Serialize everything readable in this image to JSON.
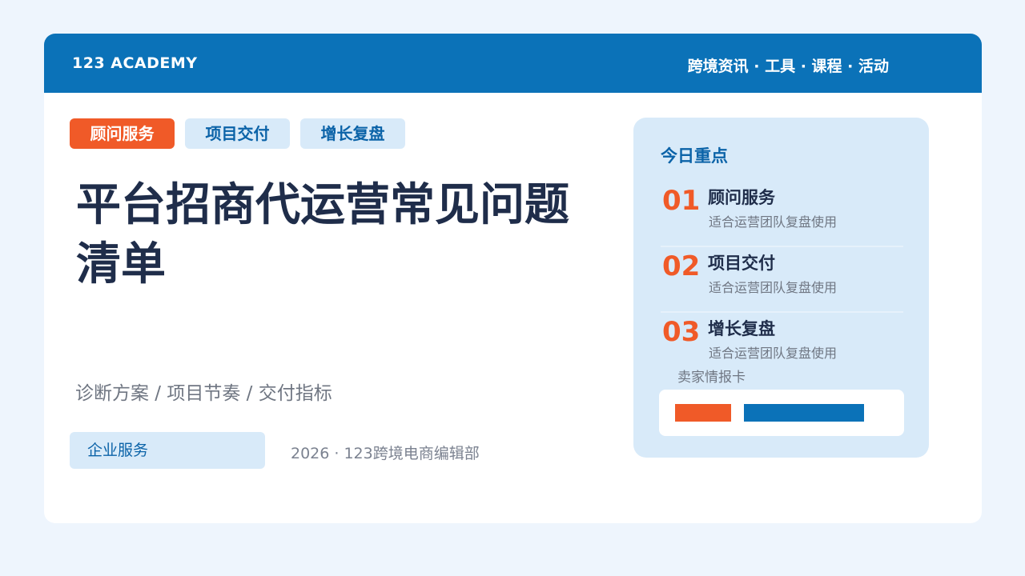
{
  "header": {
    "brand": "123 ACADEMY",
    "nav": "跨境资讯 · 工具 · 课程 · 活动"
  },
  "tags": [
    "顾问服务",
    "项目交付",
    "增长复盘"
  ],
  "main": {
    "title": "平台招商代运营常见问题清单",
    "subtitle": "诊断方案 / 项目节奏 / 交付指标",
    "badge": "企业服务",
    "footer_note": "2026 · 123跨境电商编辑部"
  },
  "panel": {
    "title": "今日重点",
    "items": [
      {
        "num": "01",
        "name": "顾问服务",
        "desc": "适合运营团队复盘使用"
      },
      {
        "num": "02",
        "name": "项目交付",
        "desc": "适合运营团队复盘使用"
      },
      {
        "num": "03",
        "name": "增长复盘",
        "desc": "适合运营团队复盘使用"
      }
    ],
    "seller_label": "卖家情报卡"
  },
  "colors": {
    "brand_blue": "#0b72b8",
    "accent_orange": "#f05a28",
    "light_blue": "#d8eaf9",
    "text_dark": "#1f2d4a"
  }
}
